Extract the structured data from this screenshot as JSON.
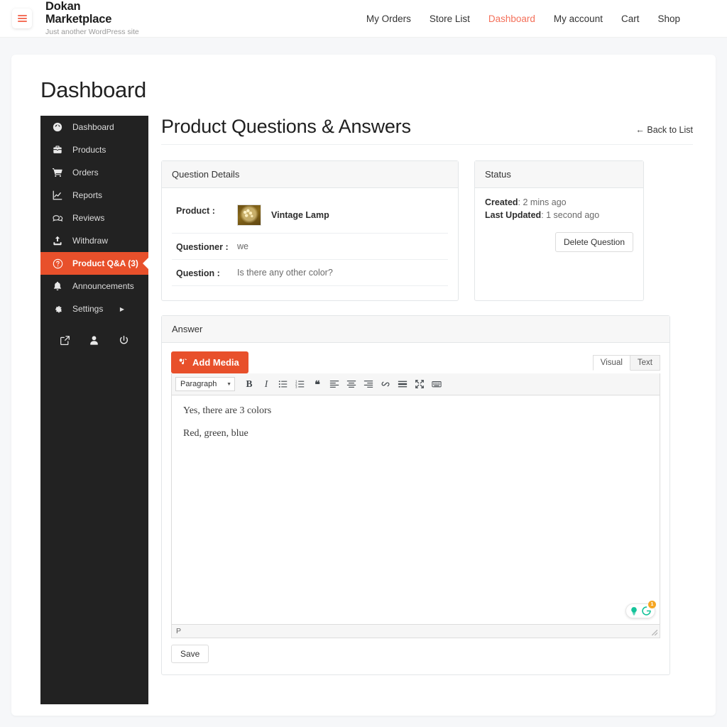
{
  "header": {
    "menu_icon": "hamburger-icon",
    "brand_line1": "Dokan",
    "brand_line2": "Marketplace",
    "tagline": "Just another WordPress site",
    "nav": [
      {
        "label": "My Orders",
        "active": false
      },
      {
        "label": "Store List",
        "active": false
      },
      {
        "label": "Dashboard",
        "active": true
      },
      {
        "label": "My account",
        "active": false
      },
      {
        "label": "Cart",
        "active": false
      },
      {
        "label": "Shop",
        "active": false
      }
    ],
    "accent_color": "#f4705a"
  },
  "page": {
    "title": "Dashboard"
  },
  "sidebar": {
    "items": [
      {
        "label": "Dashboard",
        "icon": "gauge-icon",
        "active": false
      },
      {
        "label": "Products",
        "icon": "toolbox-icon",
        "active": false
      },
      {
        "label": "Orders",
        "icon": "cart-icon",
        "active": false
      },
      {
        "label": "Reports",
        "icon": "chart-icon",
        "active": false
      },
      {
        "label": "Reviews",
        "icon": "comments-icon",
        "active": false
      },
      {
        "label": "Withdraw",
        "icon": "upload-icon",
        "active": false
      },
      {
        "label": "Product Q&A (3)",
        "icon": "question-circle-icon",
        "active": true
      },
      {
        "label": "Announcements",
        "icon": "bell-icon",
        "active": false
      },
      {
        "label": "Settings",
        "icon": "gear-icon",
        "active": false,
        "has_submenu": true
      }
    ],
    "bottom_icons": [
      "external-link-icon",
      "user-icon",
      "power-icon"
    ],
    "active_color": "#e8502b",
    "background_color": "#222222"
  },
  "main": {
    "heading": "Product Questions & Answers",
    "back_link": "← Back to List",
    "question_details": {
      "panel_title": "Question Details",
      "rows": [
        {
          "key": "Product :",
          "value": "Vintage Lamp",
          "has_thumb": true
        },
        {
          "key": "Questioner :",
          "value": "we",
          "has_thumb": false
        },
        {
          "key": "Question :",
          "value": "Is there any other color?",
          "has_thumb": false
        }
      ]
    },
    "status": {
      "panel_title": "Status",
      "created_label": "Created",
      "created_value": ": 2 mins ago",
      "updated_label": "Last Updated",
      "updated_value": ": 1 second ago",
      "delete_button": "Delete Question"
    },
    "answer": {
      "panel_title": "Answer",
      "add_media_label": "Add Media",
      "add_media_icon": "media-icon",
      "tab_visual": "Visual",
      "tab_text": "Text",
      "selected_tab": "Visual",
      "format_select": "Paragraph",
      "toolbar_icons": [
        "bold-icon",
        "italic-icon",
        "bulleted-list-icon",
        "numbered-list-icon",
        "blockquote-icon",
        "align-left-icon",
        "align-center-icon",
        "align-right-icon",
        "link-icon",
        "read-more-icon",
        "fullscreen-icon",
        "toolbar-toggle-icon"
      ],
      "content_paragraphs": [
        "Yes, there are 3 colors",
        "Red, green, blue"
      ],
      "status_bar_path": "P",
      "save_label": "Save",
      "grammarly": {
        "assistant_icon": "lightbulb-icon",
        "logo_icon": "grammarly-icon",
        "badge_count": "1",
        "badge_color": "#f5a623",
        "logo_color": "#15c39a"
      }
    }
  }
}
